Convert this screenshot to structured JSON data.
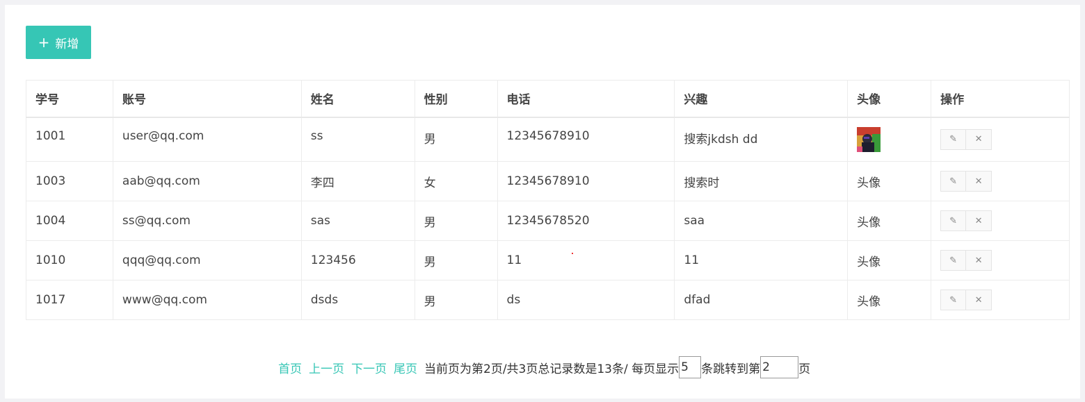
{
  "toolbar": {
    "add_label": "新增",
    "add_icon": "plus-icon"
  },
  "table": {
    "headers": [
      "学号",
      "账号",
      "姓名",
      "性别",
      "电话",
      "兴趣",
      "头像",
      "操作"
    ],
    "rows": [
      {
        "id": "1001",
        "account": "user@qq.com",
        "name": "ss",
        "gender": "男",
        "phone": "12345678910",
        "hobby": "搜索jkdsh dd",
        "avatar": ""
      },
      {
        "id": "1003",
        "account": "aab@qq.com",
        "name": "李四",
        "gender": "女",
        "phone": "12345678910",
        "hobby": "搜索时",
        "avatar": "头像"
      },
      {
        "id": "1004",
        "account": "ss@qq.com",
        "name": "sas",
        "gender": "男",
        "phone": "12345678520",
        "hobby": "saa",
        "avatar": "头像"
      },
      {
        "id": "1010",
        "account": "qqq@qq.com",
        "name": "123456",
        "gender": "男",
        "phone": "11",
        "hobby": "11",
        "avatar": "头像"
      },
      {
        "id": "1017",
        "account": "www@qq.com",
        "name": "dsds",
        "gender": "男",
        "phone": "ds",
        "hobby": "dfad",
        "avatar": "头像"
      }
    ],
    "edit_icon": "pencil-icon",
    "delete_icon": "close-icon"
  },
  "pager": {
    "first": "首页",
    "prev": "上一页",
    "next": "下一页",
    "last": "尾页",
    "info": "当前页为第2页/共3页总记录数是13条/ 每页显示",
    "page_size": "5",
    "jump_text": "条跳转到第",
    "jump_page": "2",
    "suffix": "页"
  },
  "colors": {
    "accent": "#36c6b5"
  }
}
